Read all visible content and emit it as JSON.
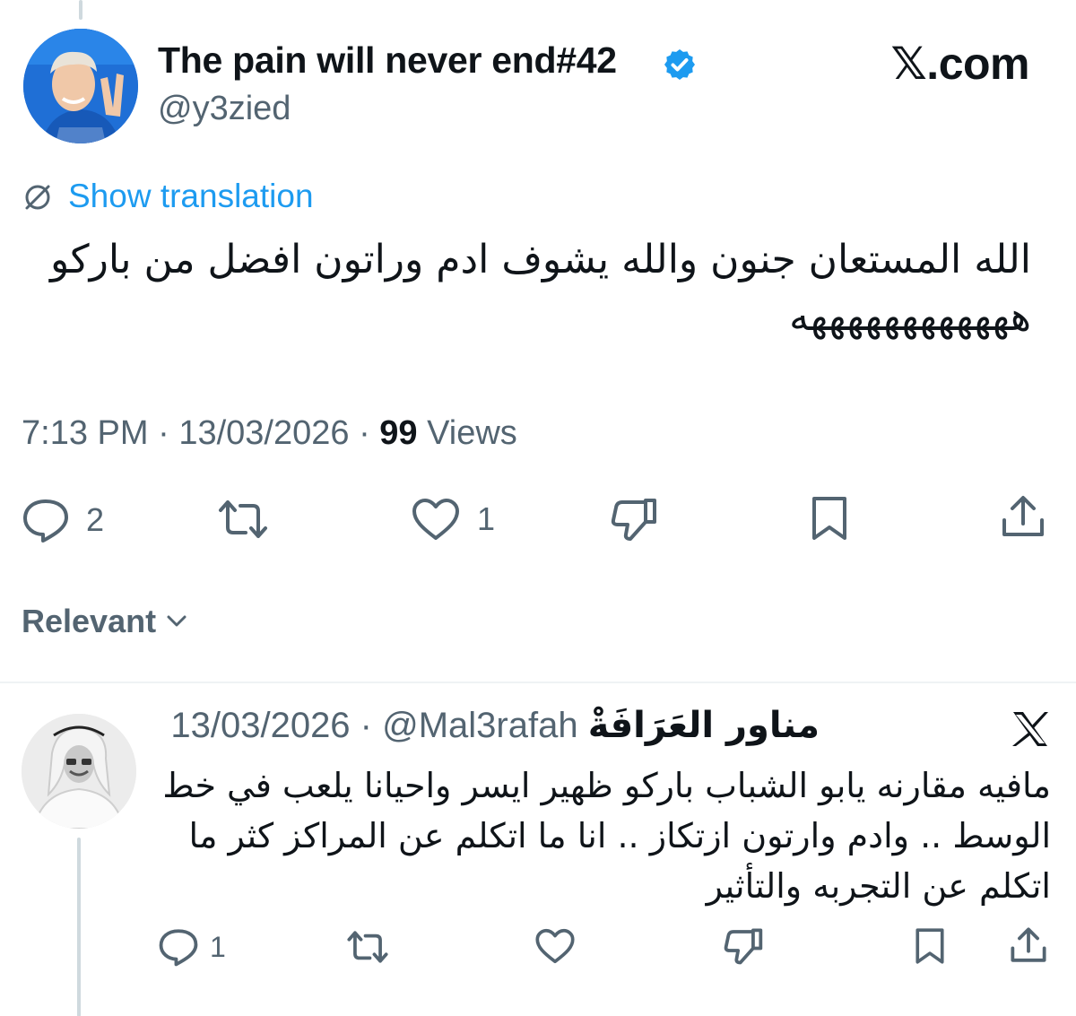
{
  "tweet": {
    "display_name": "The pain will never end#42",
    "handle": "@y3zied",
    "brand": "𝕏.com",
    "show_translation": "Show translation",
    "text": "الله المستعان جنون والله يشوف ادم وراتون افضل من باركو ههههههههههههه",
    "time": "7:13 PM",
    "date": "13/03/2026",
    "views_count": "99",
    "views_label": "Views",
    "replies": "2",
    "likes": "1",
    "icons": [
      "verified-badge-icon",
      "translate-icon",
      "reply-icon",
      "repost-icon",
      "like-icon",
      "dislike-icon",
      "bookmark-icon",
      "share-icon"
    ]
  },
  "sort": {
    "label": "Relevant"
  },
  "reply": {
    "name": "مناور العَرَافَةْ",
    "handle": "@Mal3rafah",
    "date": "13/03/2026",
    "text": "مافيه مقارنه يابو الشباب باركو ظهير ايسر واحيانا يلعب في خط الوسط .. وادم وارتون ازتكاز .. انا ما اتكلم عن المراكز كثر ما اتكلم عن التجربه والتأثير",
    "replies": "1",
    "icons": [
      "x-logo-icon",
      "reply-icon",
      "repost-icon",
      "like-icon",
      "dislike-icon",
      "bookmark-icon",
      "share-icon"
    ]
  },
  "colors": {
    "text": "#0f1419",
    "secondary": "#536471",
    "link": "#1d9bf0",
    "verified": "#1d9bf0"
  }
}
